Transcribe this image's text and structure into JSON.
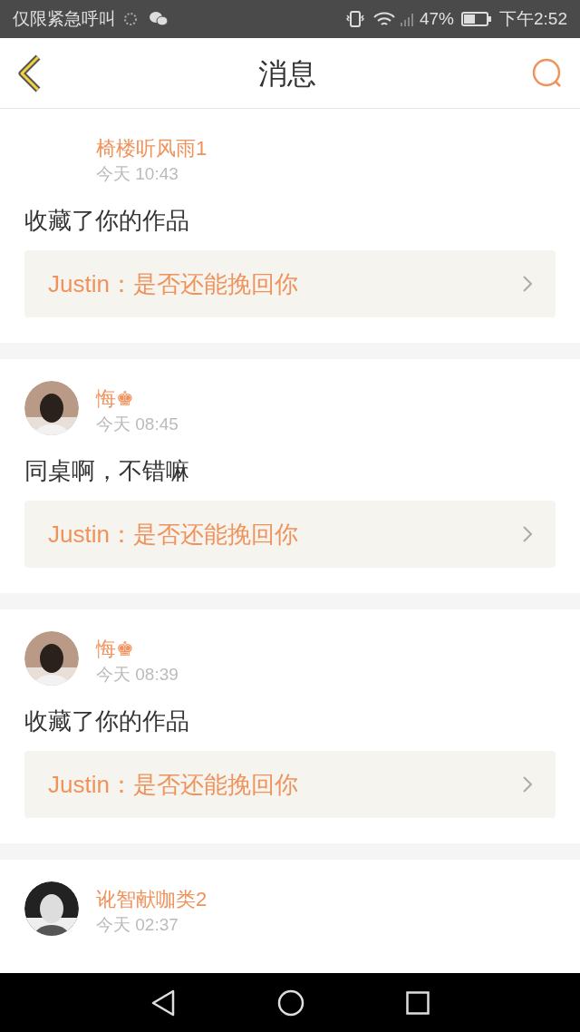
{
  "status_bar": {
    "left_text": "仅限紧急呼叫",
    "battery": "47%",
    "time": "下午2:52"
  },
  "header": {
    "title": "消息"
  },
  "messages": [
    {
      "avatar": false,
      "name": "椅楼听风雨1",
      "time": "今天 10:43",
      "text": "收藏了你的作品",
      "reply": "Justin：是否还能挽回你"
    },
    {
      "avatar": true,
      "name": "悔♚",
      "time": "今天 08:45",
      "text": "同桌啊，不错嘛",
      "reply": "Justin：是否还能挽回你"
    },
    {
      "avatar": true,
      "name": "悔♚",
      "time": "今天 08:39",
      "text": "收藏了你的作品",
      "reply": "Justin：是否还能挽回你"
    },
    {
      "avatar": true,
      "name": "讹智献咖类2",
      "time": "今天 02:37"
    }
  ]
}
